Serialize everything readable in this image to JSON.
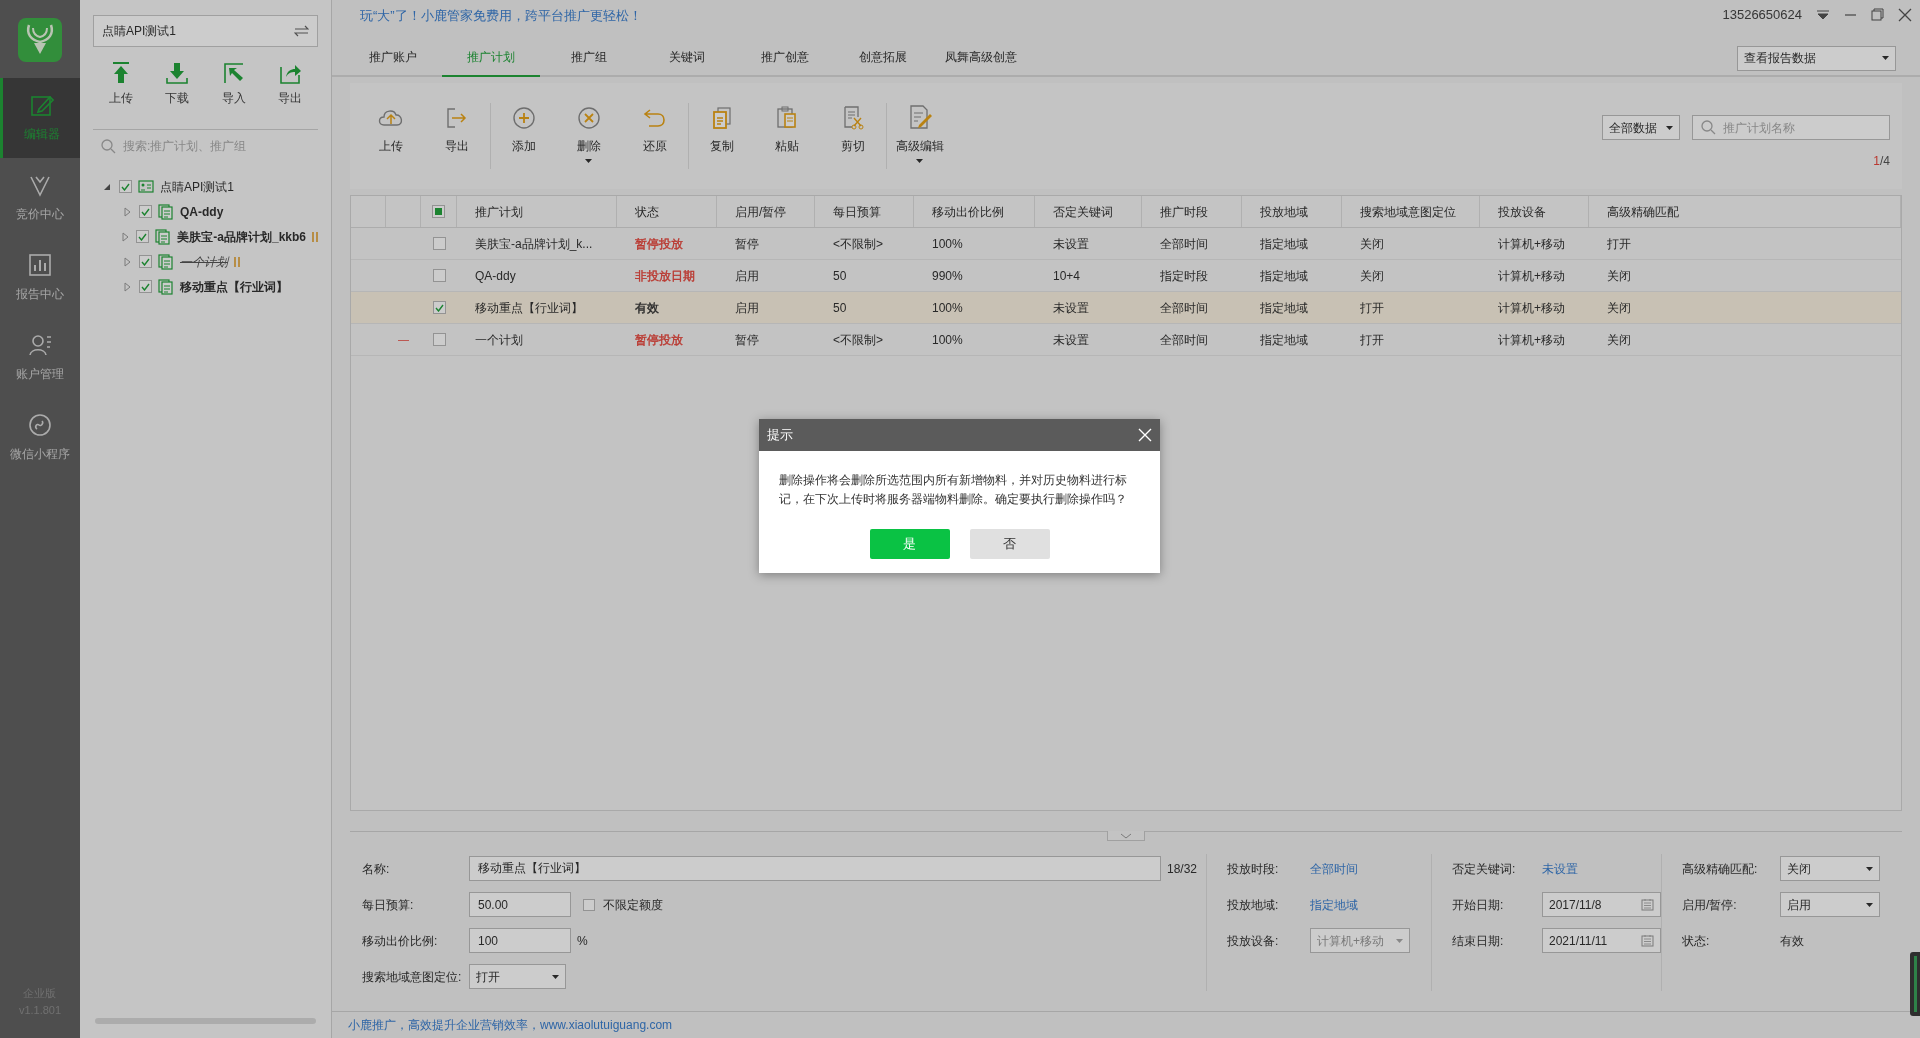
{
  "app": {
    "edition": "企业版",
    "version": "v1.1.801"
  },
  "nav": [
    {
      "kind": "editor",
      "label": "编辑器",
      "selected": true
    },
    {
      "kind": "bidding",
      "label": "竞价中心",
      "selected": false
    },
    {
      "kind": "report",
      "label": "报告中心",
      "selected": false
    },
    {
      "kind": "account",
      "label": "账户管理",
      "selected": false
    },
    {
      "kind": "miniapp",
      "label": "微信小程序",
      "selected": false
    }
  ],
  "account_selector": {
    "value": "点睛API测试1"
  },
  "tree_toolbar": [
    {
      "kind": "upload",
      "label": "上传"
    },
    {
      "kind": "download",
      "label": "下载"
    },
    {
      "kind": "import",
      "label": "导入"
    },
    {
      "kind": "export",
      "label": "导出"
    }
  ],
  "tree_search": {
    "placeholder": "搜索:推广计划、推广组"
  },
  "tree": [
    {
      "label": "点睛API测试1",
      "checked": true,
      "expanded": true,
      "children": [
        {
          "label": "QA-ddy",
          "checked": true,
          "expanded": false,
          "paused": false,
          "deleted": false
        },
        {
          "label": "美肤宝-a品牌计划_kkb6",
          "checked": true,
          "expanded": false,
          "paused": true,
          "deleted": false
        },
        {
          "label": "一个计划",
          "checked": true,
          "expanded": false,
          "paused": true,
          "deleted": true
        },
        {
          "label": "移动重点【行业词】",
          "checked": true,
          "expanded": false,
          "paused": false,
          "deleted": false
        }
      ]
    }
  ],
  "banner": "玩“大”了！小鹿管家免费用，跨平台推广更轻松！",
  "user": {
    "phone": "13526650624"
  },
  "tabs": [
    {
      "label": "推广账户",
      "selected": false
    },
    {
      "label": "推广计划",
      "selected": true
    },
    {
      "label": "推广组",
      "selected": false
    },
    {
      "label": "关键词",
      "selected": false
    },
    {
      "label": "推广创意",
      "selected": false
    },
    {
      "label": "创意拓展",
      "selected": false
    },
    {
      "label": "凤舞高级创意",
      "selected": false
    }
  ],
  "report_select": {
    "value": "查看报告数据"
  },
  "toolbar": [
    {
      "kind": "cloud-upload",
      "label": "上传",
      "has_menu": false,
      "group_end": false
    },
    {
      "kind": "export",
      "label": "导出",
      "has_menu": false,
      "group_end": true
    },
    {
      "kind": "add",
      "label": "添加",
      "has_menu": false,
      "group_end": false
    },
    {
      "kind": "delete",
      "label": "删除",
      "has_menu": true,
      "group_end": false
    },
    {
      "kind": "restore",
      "label": "还原",
      "has_menu": false,
      "group_end": true
    },
    {
      "kind": "copy",
      "label": "复制",
      "has_menu": false,
      "group_end": false
    },
    {
      "kind": "paste",
      "label": "粘贴",
      "has_menu": false,
      "group_end": false
    },
    {
      "kind": "cut",
      "label": "剪切",
      "has_menu": false,
      "group_end": true
    },
    {
      "kind": "edit",
      "label": "高级编辑",
      "has_menu": true,
      "group_end": false
    }
  ],
  "filter": {
    "value": "全部数据"
  },
  "plan_search": {
    "placeholder": "推广计划名称"
  },
  "pager": {
    "current": "1",
    "total": "/4"
  },
  "table": {
    "header_partial": true,
    "columns": [
      "推广计划",
      "状态",
      "启用/暂停",
      "每日预算",
      "移动出价比例",
      "否定关键词",
      "推广时段",
      "投放地域",
      "搜索地域意图定位",
      "投放设备",
      "高级精确匹配"
    ],
    "rows": [
      {
        "checked": false,
        "selected": false,
        "color": "#ba3830",
        "cells": [
          "美肤宝-a品牌计划_k...",
          "暂停投放",
          "暂停",
          "<不限制>",
          "100%",
          "未设置",
          "全部时间",
          "指定地域",
          "关闭",
          "计算机+移动",
          "打开"
        ]
      },
      {
        "checked": false,
        "selected": false,
        "color": "#ba3830",
        "cells": [
          "QA-ddy",
          "非投放日期",
          "启用",
          "50",
          "990%",
          "10+4",
          "指定时段",
          "指定地域",
          "关闭",
          "计算机+移动",
          "关闭"
        ]
      },
      {
        "checked": true,
        "selected": true,
        "color": "#2a2a2a",
        "cells": [
          "移动重点【行业词】",
          "有效",
          "启用",
          "50",
          "100%",
          "未设置",
          "全部时间",
          "指定地域",
          "打开",
          "计算机+移动",
          "关闭"
        ]
      },
      {
        "marker": "—",
        "checked": false,
        "selected": false,
        "color": "#ba3830",
        "cells": [
          "一个计划",
          "暂停投放",
          "暂停",
          "<不限制>",
          "100%",
          "未设置",
          "全部时间",
          "指定地域",
          "打开",
          "计算机+移动",
          "关闭"
        ]
      }
    ]
  },
  "detail": {
    "columns": [
      [
        {
          "kind": "text",
          "label": "名称:",
          "value": "移动重点【行业词】",
          "suffix": "18/32"
        },
        {
          "kind": "number",
          "label": "每日预算:",
          "value": "50.00",
          "option": "不限定额度",
          "option_checked": false
        },
        {
          "kind": "number",
          "label": "移动出价比例:",
          "value": "100",
          "suffix": "%"
        },
        {
          "kind": "select",
          "label": "搜索地域意图定位:",
          "value": "打开",
          "disabled": false
        }
      ],
      [
        {
          "kind": "link",
          "label": "投放时段:",
          "value": "全部时间"
        },
        {
          "kind": "link",
          "label": "投放地域:",
          "value": "指定地域"
        },
        {
          "kind": "select",
          "label": "投放设备:",
          "value": "计算机+移动",
          "disabled": true
        }
      ],
      [
        {
          "kind": "link",
          "label": "否定关键词:",
          "value": "未设置"
        },
        {
          "kind": "date",
          "label": "开始日期:",
          "value": "2017/11/8"
        },
        {
          "kind": "date",
          "label": "结束日期:",
          "value": "2021/11/11"
        }
      ],
      [
        {
          "kind": "select",
          "label": "高级精确匹配:",
          "value": "关闭",
          "disabled": false
        },
        {
          "kind": "select",
          "label": "启用/暂停:",
          "value": "启用",
          "disabled": false
        },
        {
          "kind": "plain",
          "label": "状态:",
          "value": "有效"
        }
      ]
    ]
  },
  "footer": "小鹿推广，高效提升企业营销效率，www.xiaolutuiguang.com",
  "dialog": {
    "title": "提示",
    "message": "删除操作将会删除所选范围内所有新增物料，并对历史物料进行标记，在下次上传时将服务器端物料删除。确定要执行删除操作吗？",
    "buttons": [
      {
        "label": "是",
        "primary": true
      },
      {
        "label": "否",
        "primary": false
      }
    ]
  }
}
